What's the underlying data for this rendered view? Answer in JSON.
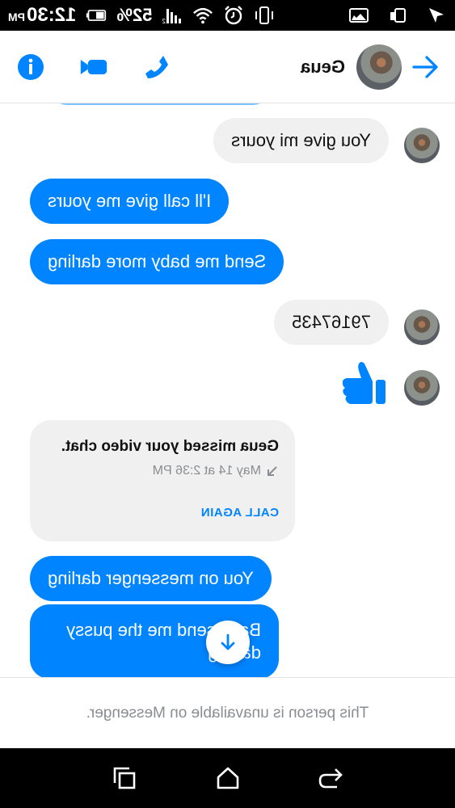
{
  "status_bar": {
    "time": "12:30",
    "ampm": "PM",
    "battery_percent": "52%",
    "icons": [
      "nav-arrow-icon",
      "screen-icon",
      "image-icon",
      "vibrate-icon",
      "alarm-icon",
      "wifi-icon",
      "signal-icon",
      "battery-icon"
    ]
  },
  "header": {
    "contact_name": "Geua",
    "actions": [
      "phone-icon",
      "video-icon",
      "info-icon"
    ],
    "accent_color": "#0084ff"
  },
  "messages": [
    {
      "direction": "in",
      "text": "You give mi yours"
    },
    {
      "direction": "out",
      "text": "I'll call give me yours"
    },
    {
      "direction": "out",
      "text": "Send me baby more darling"
    },
    {
      "direction": "in",
      "text": "79167435"
    },
    {
      "direction": "in",
      "type": "like"
    },
    {
      "direction": "out",
      "text": "You on messenger darling"
    },
    {
      "direction": "out",
      "text": "Baby send me the pussy darling"
    }
  ],
  "missed_call": {
    "title": "Geua missed your video chat.",
    "time": "May 14 at 2:36 PM",
    "action_label": "CALL AGAIN"
  },
  "footer": {
    "notice": "This person is unavailable on Messenger."
  },
  "nav_bar": {
    "icons": [
      "back-icon",
      "home-icon",
      "recents-icon"
    ]
  }
}
